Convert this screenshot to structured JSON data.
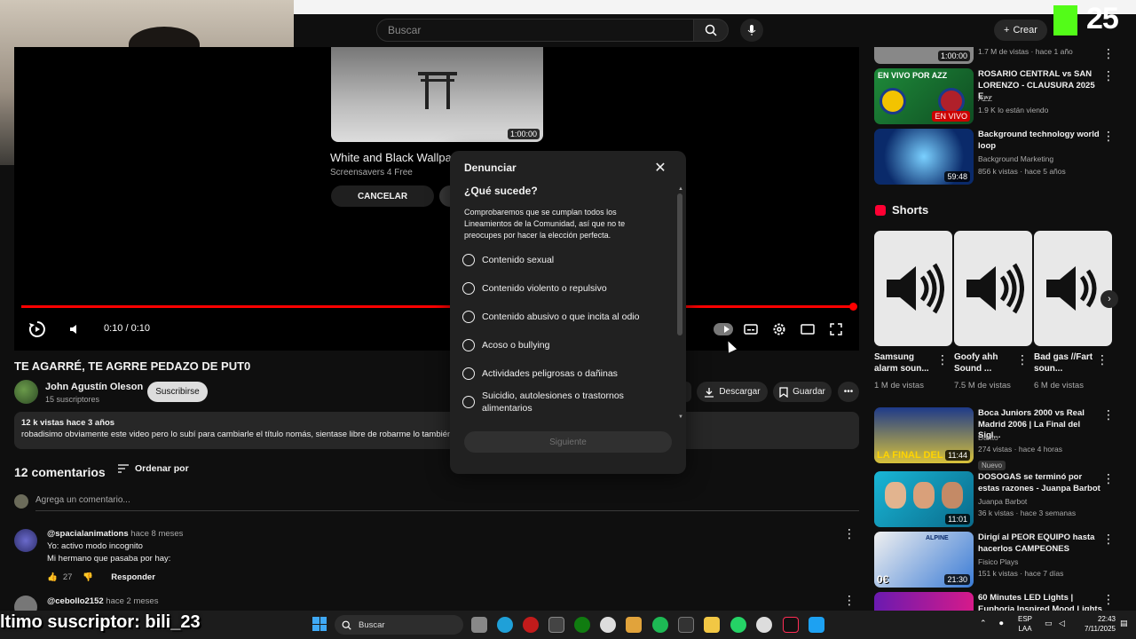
{
  "header": {
    "search_placeholder": "Buscar",
    "create_label": "Crear"
  },
  "stream": {
    "logo": "25",
    "subscriber_text": "ltimo suscriptor: bili_23"
  },
  "end_screen": {
    "title": "White and Black Wallpape",
    "channel": "Screensavers 4 Free",
    "duration": "1:00:00",
    "cancel_label": "CANCELAR"
  },
  "player": {
    "time": "0:10 / 0:10",
    "progress": 1.0
  },
  "video": {
    "title": "TE AGARRÉ, TE AGRRE PEDAZO DE PUT0",
    "channel": "John Agustín Oleson",
    "subscribers": "15 suscriptores",
    "subscribe_label": "Suscribirse",
    "download_label": "Descargar",
    "save_label": "Guardar",
    "stats": "12 k vistas  hace 3 años",
    "description": "robadisimo obviamente este video pero lo subí para cambiarle el título nomás, sientase libre de robarme lo también x"
  },
  "comments": {
    "count_label": "12 comentarios",
    "sort_label": "Ordenar por",
    "add_placeholder": "Agrega un comentario...",
    "items": [
      {
        "author": "@spacialanimations",
        "time": "hace 8 meses",
        "lines": [
          "Yo: activo modo incognito",
          "Mi hermano que pasaba por hay:"
        ],
        "likes": "27",
        "reply_label": "Responder"
      },
      {
        "author": "@cebollo2152",
        "time": "hace 2 meses"
      }
    ]
  },
  "modal": {
    "title": "Denunciar",
    "question": "¿Qué sucede?",
    "description": "Comprobaremos que se cumplan todos los Lineamientos de la Comunidad, así que no te preocupes por hacer la elección perfecta.",
    "options": [
      "Contenido sexual",
      "Contenido violento o repulsivo",
      "Contenido abusivo o que incita al odio",
      "Acoso o bullying",
      "Actividades peligrosas o dañinas",
      "Suicidio, autolesiones o trastornos alimentarios"
    ],
    "next_label": "Siguiente"
  },
  "sidebar": {
    "top_item": {
      "duration": "1:00:00",
      "meta": "1.7 M de vistas · hace 1 año"
    },
    "items": [
      {
        "title": "ROSARIO CENTRAL vs SAN LORENZO - CLAUSURA 2025 E...",
        "channel": "AZZ",
        "meta": "1.9 K lo están viendo",
        "thumb_label": "EN VIVO POR",
        "thumb_brand": "AZZ",
        "live": "EN VIVO"
      },
      {
        "title": "Background technology world loop",
        "channel": "Background Marketing",
        "meta": "856 k vistas · hace 5 años",
        "duration": "59:48"
      },
      {
        "title": "Boca Juniors 2000 vs Real Madrid 2006 | La Final del Sigl...",
        "channel": "Darito",
        "meta": "274 vistas · hace 4 horas",
        "badge": "Nuevo",
        "duration": "11:44",
        "thumb_caption": "LA FINAL DEL S"
      },
      {
        "title": "DOSOGAS se terminó por estas razones - Juanpa Barbot",
        "channel": "Juanpa Barbot",
        "meta": "36 k vistas · hace 3 semanas",
        "duration": "11:01"
      },
      {
        "title": "Dirigí al PEOR EQUIPO hasta hacerlos CAMPEONES",
        "channel": "Fisico Plays",
        "meta": "151 k vistas · hace 7 días",
        "duration": "21:30",
        "thumb_caption": "0€",
        "thumb_brand": "ALPINE"
      },
      {
        "title": "60 Minutes LED Lights | Euphoria Inspired Mood Lights"
      }
    ],
    "shorts_title": "Shorts",
    "shorts": [
      {
        "title": "Samsung alarm soun...",
        "meta": "1 M de vistas"
      },
      {
        "title": "Goofy ahh Sound ...",
        "meta": "7.5 M de vistas"
      },
      {
        "title": "Bad gas //Fart soun...",
        "meta": "6 M de vistas"
      }
    ]
  },
  "taskbar": {
    "search_label": "Buscar",
    "lang": "ESP",
    "lang2": "LAA",
    "time": "22:43",
    "date": "7/11/2025"
  }
}
